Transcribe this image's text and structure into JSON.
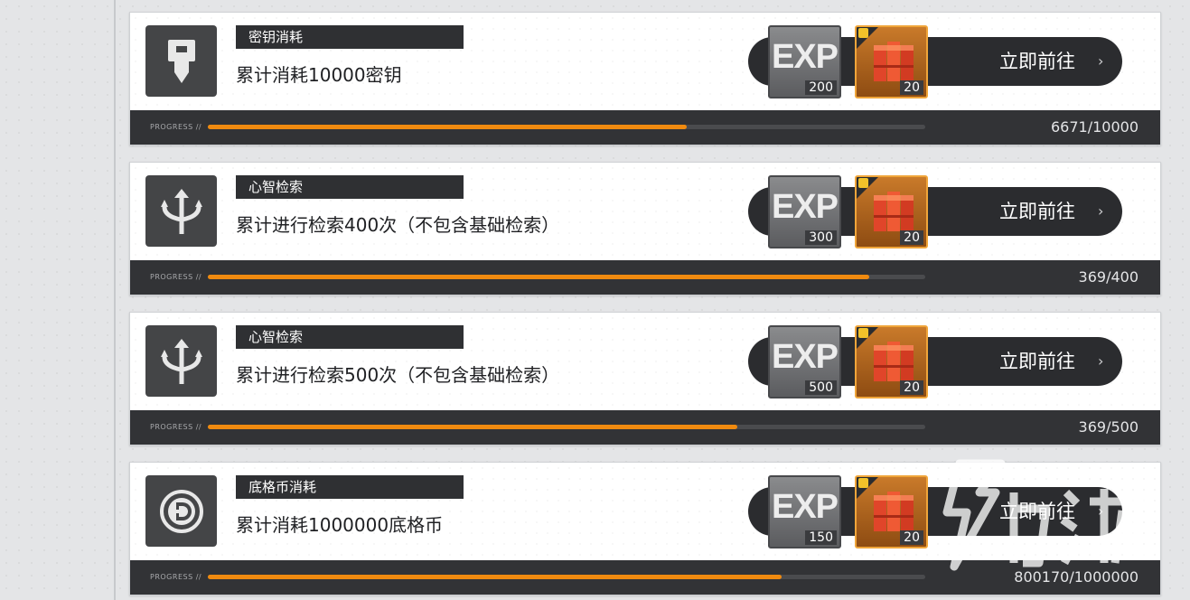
{
  "colors": {
    "accent": "#f08a0f",
    "card_background": "#ffffff",
    "dark_panel": "#2b2c2f",
    "progress_track": "#4a4b4e"
  },
  "progress_label": "PROGRESS //",
  "tasks": [
    {
      "icon": "key-icon",
      "category": "密钥消耗",
      "description": "累计消耗10000密钥",
      "exp_label": "EXP",
      "exp_amount": "200",
      "item_amount": "20",
      "go_label": "立即前往",
      "progress_text": "6671/10000",
      "progress_fraction": 0.6671
    },
    {
      "icon": "trident-icon",
      "category": "心智检索",
      "description": "累计进行检索400次（不包含基础检索）",
      "exp_label": "EXP",
      "exp_amount": "300",
      "item_amount": "20",
      "go_label": "立即前往",
      "progress_text": "369/400",
      "progress_fraction": 0.9225
    },
    {
      "icon": "trident-icon",
      "category": "心智检索",
      "description": "累计进行检索500次（不包含基础检索）",
      "exp_label": "EXP",
      "exp_amount": "500",
      "item_amount": "20",
      "go_label": "立即前往",
      "progress_text": "369/500",
      "progress_fraction": 0.738
    },
    {
      "icon": "coin-icon",
      "category": "底格币消耗",
      "description": "累计消耗1000000底格币",
      "exp_label": "EXP",
      "exp_amount": "150",
      "item_amount": "20",
      "go_label": "立即前往",
      "progress_text": "800170/1000000",
      "progress_fraction": 0.80017
    }
  ]
}
